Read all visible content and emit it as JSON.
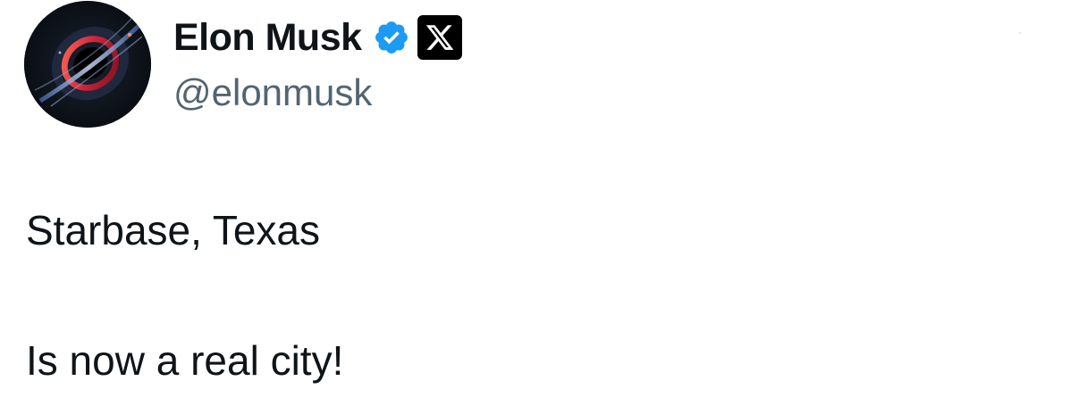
{
  "author": {
    "display_name": "Elon Musk",
    "handle": "@elonmusk",
    "avatar_icon": "black-hole-avatar",
    "verified_icon": "verified-badge-icon",
    "affiliation_icon": "x-logo-icon"
  },
  "tweet": {
    "lines": [
      "Starbase, Texas",
      "Is now a real city!"
    ]
  },
  "colors": {
    "text_primary": "#0f1419",
    "text_secondary": "#536471",
    "verified_blue": "#1d9bf0",
    "badge_black": "#000000",
    "background": "#ffffff"
  }
}
